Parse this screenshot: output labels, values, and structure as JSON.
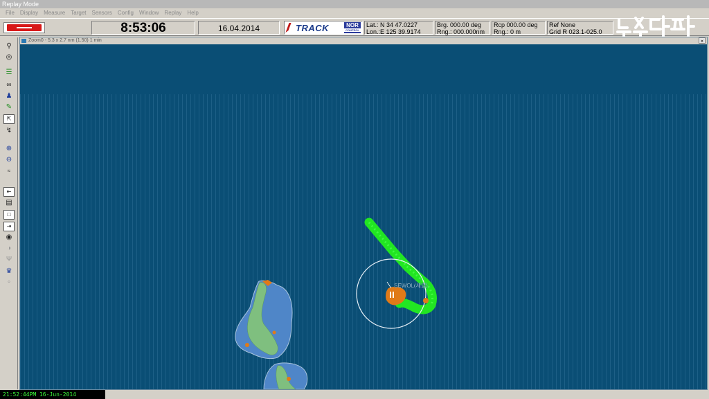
{
  "window": {
    "title": "Replay Mode"
  },
  "menu": [
    "File",
    "Display",
    "Measure",
    "Target",
    "Sensors",
    "Config",
    "Window",
    "Replay",
    "Help"
  ],
  "info": {
    "time": "8:53:06",
    "date": "16.04.2014",
    "brand": "TRACK",
    "brand2": "NOR",
    "brand2_sub": "CONTROL",
    "lat": "Lat.: N 34 47.0227",
    "lon": "Lon.:E 125 39.9174",
    "brg": "Brg. 000.00 deg",
    "rng": "Rng.: 000.000nm",
    "rcp": "Rcp  000.00  deg",
    "rng2": "Rng.: 0         m",
    "ref": "Ref  None",
    "grid": "Grid R 023.1-025.0"
  },
  "toolbar": {
    "icons": [
      "search-icon",
      "target-icon",
      "layers-icon",
      "binoculars-track-icon",
      "person-icon",
      "pen-icon",
      "cursor-select-icon",
      "lightning-icon",
      "zoom-in-icon",
      "zoom-out-icon",
      "range-icon",
      "panel-in-icon",
      "book-icon",
      "window-icon",
      "panel-out-icon",
      "binoculars-icon",
      "radar-dim-icon",
      "antenna-dim-icon",
      "user-pen-icon",
      "wand-dim-icon"
    ]
  },
  "zoom": {
    "title": "Zoom0  -  5.3 x 2.7 nm (1.50) 1 min",
    "close": "×",
    "target_label": "SEWOL(세월)"
  },
  "status": {
    "text": "21:52:44PM 16-Jun-2014"
  },
  "watermark": "뉴스타파",
  "colors": {
    "sea": "#0a4e75",
    "track": "#22e622",
    "echo": "#e07a18",
    "island": "#7fbf7f",
    "island_shallow": "#4f86c8"
  }
}
